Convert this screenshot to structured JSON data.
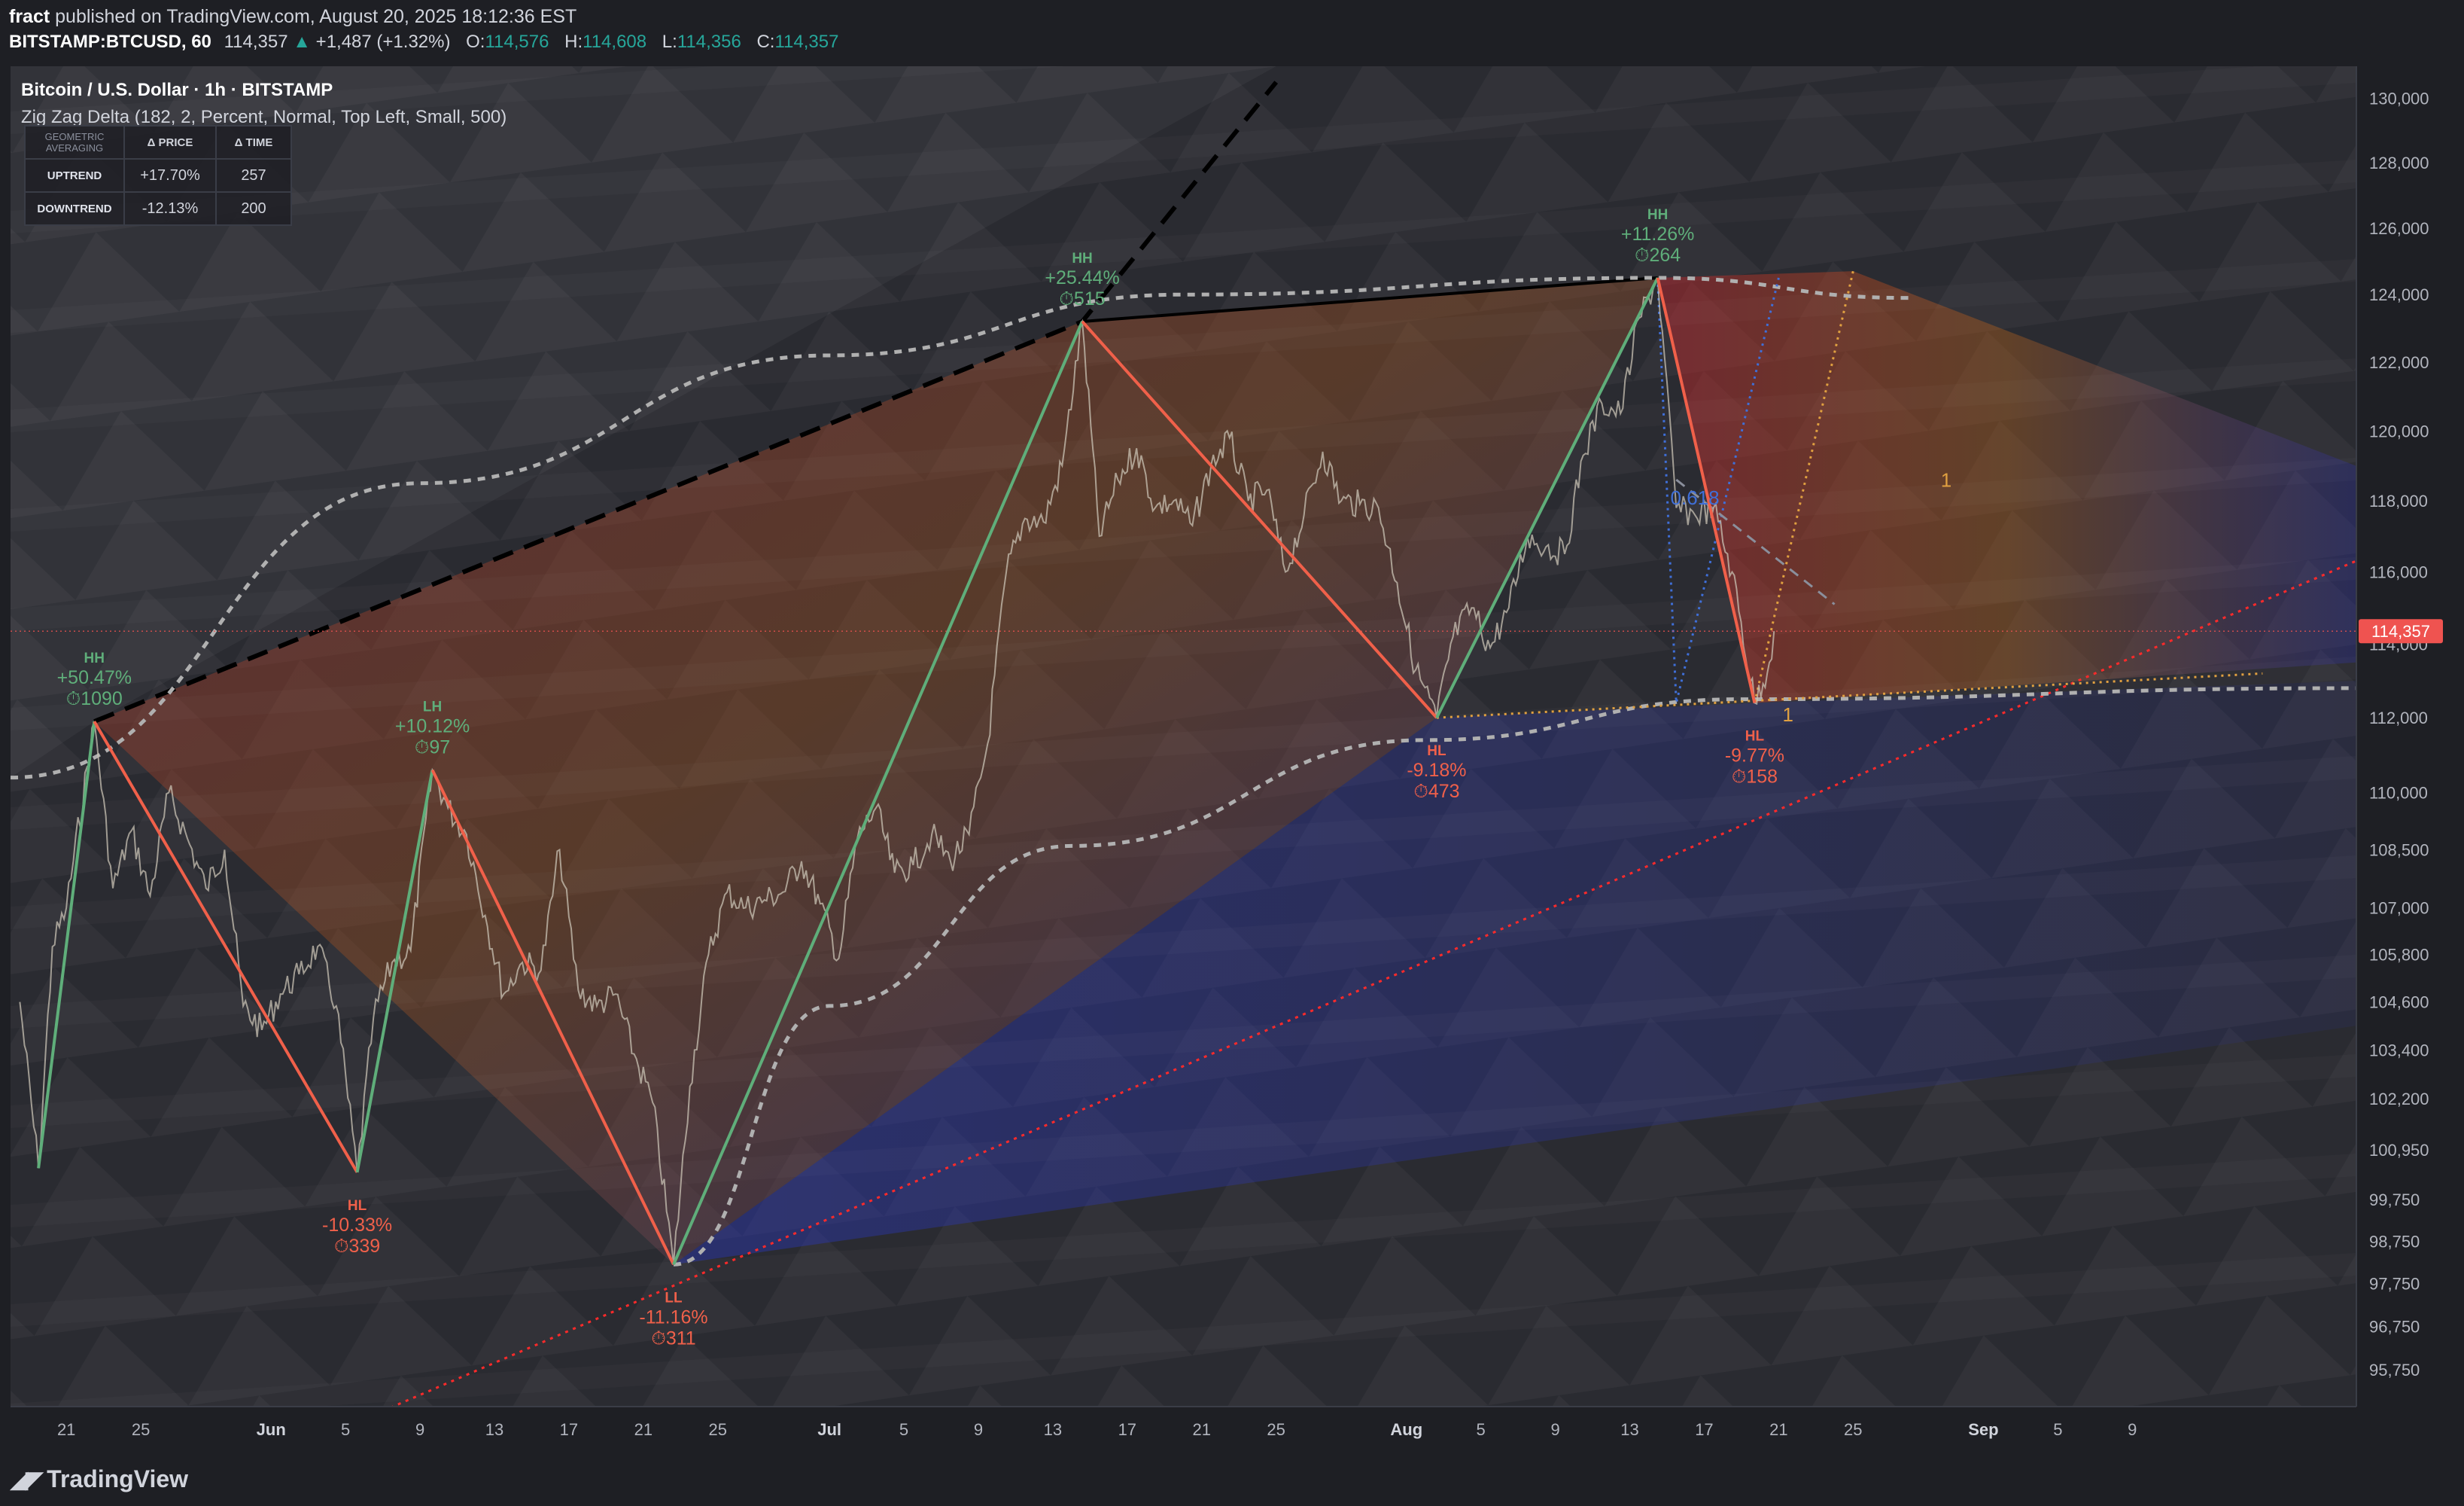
{
  "header": {
    "author": "fract",
    "published": "published on TradingView.com, August 20, 2025 18:12:36 EST",
    "symbol": "BITSTAMP:BTCUSD, 60",
    "last": "114,357",
    "change_arrow": "▲",
    "change": "+1,487 (+1.32%)",
    "open_label": "O:",
    "open": "114,576",
    "high_label": "H:",
    "high": "114,608",
    "low_label": "L:",
    "low": "114,356",
    "close_label": "C:",
    "close": "114,357"
  },
  "legend": {
    "title": "Bitcoin / U.S. Dollar · 1h · BITSTAMP",
    "indicator": "Zig Zag Delta (182, 2, Percent, Normal, Top Left, Small, 500)"
  },
  "stats_table": {
    "corner": "GEOMETRIC AVERAGING",
    "col_price": "Δ PRICE",
    "col_time": "Δ TIME",
    "rows": [
      {
        "label": "UPTREND",
        "price": "+17.70%",
        "time": "257"
      },
      {
        "label": "DOWNTREND",
        "price": "-12.13%",
        "time": "200"
      }
    ]
  },
  "footer": {
    "brand": "TradingView",
    "brand_icon": "tradingview-logo-icon"
  },
  "colors": {
    "background": "#1e1f24",
    "up": "#26a69a",
    "down": "#ef5350",
    "zig_up": "#5fae7a",
    "zig_down": "#f0604a",
    "label_up": "#5fae7a",
    "label_down": "#f0604a",
    "price_badge": "#ef5350",
    "trend_dotted": "#ff2a2a",
    "ext_dashed": "#b0b0b0"
  },
  "chart_data": {
    "type": "line",
    "title": "Bitcoin / U.S. Dollar · 1h · BITSTAMP",
    "y_scale": "log",
    "ylim": [
      94900,
      131000
    ],
    "y_ticks": [
      95750,
      96750,
      97750,
      98750,
      99750,
      100950,
      102200,
      103400,
      104600,
      105800,
      107000,
      108500,
      110000,
      112000,
      114000,
      116000,
      118000,
      120000,
      122000,
      124000,
      126000,
      128000,
      130000
    ],
    "y_tick_labels": [
      "95,750",
      "96,750",
      "97,750",
      "98,750",
      "99,750",
      "100,950",
      "102,200",
      "103,400",
      "104,600",
      "105,800",
      "107,000",
      "108,500",
      "110,000",
      "112,000",
      "114,000",
      "116,000",
      "118,000",
      "120,000",
      "122,000",
      "124,000",
      "126,000",
      "128,000",
      "130,000"
    ],
    "xlim": [
      "2025-05-18",
      "2025-09-21"
    ],
    "x_ticks": [
      {
        "date": "2025-05-21",
        "label": "21"
      },
      {
        "date": "2025-05-25",
        "label": "25"
      },
      {
        "date": "2025-06-01",
        "label": "Jun"
      },
      {
        "date": "2025-06-05",
        "label": "5"
      },
      {
        "date": "2025-06-09",
        "label": "9"
      },
      {
        "date": "2025-06-13",
        "label": "13"
      },
      {
        "date": "2025-06-17",
        "label": "17"
      },
      {
        "date": "2025-06-21",
        "label": "21"
      },
      {
        "date": "2025-06-25",
        "label": "25"
      },
      {
        "date": "2025-07-01",
        "label": "Jul"
      },
      {
        "date": "2025-07-05",
        "label": "5"
      },
      {
        "date": "2025-07-09",
        "label": "9"
      },
      {
        "date": "2025-07-13",
        "label": "13"
      },
      {
        "date": "2025-07-17",
        "label": "17"
      },
      {
        "date": "2025-07-21",
        "label": "21"
      },
      {
        "date": "2025-07-25",
        "label": "25"
      },
      {
        "date": "2025-08-01",
        "label": "Aug"
      },
      {
        "date": "2025-08-05",
        "label": "5"
      },
      {
        "date": "2025-08-09",
        "label": "9"
      },
      {
        "date": "2025-08-13",
        "label": "13"
      },
      {
        "date": "2025-08-17",
        "label": "17"
      },
      {
        "date": "2025-08-21",
        "label": "21"
      },
      {
        "date": "2025-08-25",
        "label": "25"
      },
      {
        "date": "2025-09-01",
        "label": "Sep"
      },
      {
        "date": "2025-09-05",
        "label": "5"
      },
      {
        "date": "2025-09-09",
        "label": "9"
      }
    ],
    "last_price": 114357,
    "last_price_label": "114,357",
    "zigzag": [
      {
        "date": "2025-05-19T12:00",
        "price": 100500
      },
      {
        "date": "2025-05-22T12:00",
        "price": 111900,
        "type": "HH",
        "delta": "+50.47%",
        "bars": "⏱1090",
        "dir": "up"
      },
      {
        "date": "2025-06-05T15:00",
        "price": 100400,
        "type": "HL",
        "delta": "-10.33%",
        "bars": "⏱339",
        "dir": "down"
      },
      {
        "date": "2025-06-09T16:00",
        "price": 110600,
        "type": "LH",
        "delta": "+10.12%",
        "bars": "⏱97",
        "dir": "up"
      },
      {
        "date": "2025-06-22T15:00",
        "price": 98200,
        "type": "LL",
        "delta": "-11.16%",
        "bars": "⏱311",
        "dir": "down"
      },
      {
        "date": "2025-07-14T14:00",
        "price": 123200,
        "type": "HH",
        "delta": "+25.44%",
        "bars": "⏱515",
        "dir": "up"
      },
      {
        "date": "2025-08-02T15:00",
        "price": 112000,
        "type": "HL",
        "delta": "-9.18%",
        "bars": "⏱473",
        "dir": "down"
      },
      {
        "date": "2025-08-14T12:00",
        "price": 124500,
        "type": "HH",
        "delta": "+11.26%",
        "bars": "⏱264",
        "dir": "up"
      },
      {
        "date": "2025-08-19T17:00",
        "price": 112400,
        "type": "HL",
        "delta": "-9.77%",
        "bars": "⏱158",
        "dir": "down"
      }
    ],
    "price_path": [
      [
        "2025-05-18T12:00",
        104600
      ],
      [
        "2025-05-19T12:00",
        100500
      ],
      [
        "2025-05-20T06:00",
        106000
      ],
      [
        "2025-05-21T00:00",
        107000
      ],
      [
        "2025-05-22T12:00",
        111900
      ],
      [
        "2025-05-23T12:00",
        107500
      ],
      [
        "2025-05-24T12:00",
        109000
      ],
      [
        "2025-05-25T12:00",
        107300
      ],
      [
        "2025-05-26T12:00",
        110000
      ],
      [
        "2025-05-27T12:00",
        108800
      ],
      [
        "2025-05-28T12:00",
        107500
      ],
      [
        "2025-05-29T12:00",
        108500
      ],
      [
        "2025-05-30T12:00",
        104500
      ],
      [
        "2025-05-31T12:00",
        103900
      ],
      [
        "2025-06-01T12:00",
        104800
      ],
      [
        "2025-06-02T12:00",
        105300
      ],
      [
        "2025-06-03T12:00",
        106000
      ],
      [
        "2025-06-04T12:00",
        104500
      ],
      [
        "2025-06-05T15:00",
        100400
      ],
      [
        "2025-06-06T12:00",
        104200
      ],
      [
        "2025-06-07T12:00",
        105600
      ],
      [
        "2025-06-08T12:00",
        105900
      ],
      [
        "2025-06-09T16:00",
        110600
      ],
      [
        "2025-06-10T12:00",
        109600
      ],
      [
        "2025-06-11T12:00",
        108900
      ],
      [
        "2025-06-12T12:00",
        106800
      ],
      [
        "2025-06-13T12:00",
        104800
      ],
      [
        "2025-06-14T12:00",
        105600
      ],
      [
        "2025-06-15T12:00",
        105400
      ],
      [
        "2025-06-16T12:00",
        108500
      ],
      [
        "2025-06-17T12:00",
        104900
      ],
      [
        "2025-06-18T12:00",
        104500
      ],
      [
        "2025-06-19T12:00",
        104800
      ],
      [
        "2025-06-20T12:00",
        103300
      ],
      [
        "2025-06-21T12:00",
        102100
      ],
      [
        "2025-06-22T15:00",
        98200
      ],
      [
        "2025-06-23T12:00",
        102500
      ],
      [
        "2025-06-24T12:00",
        105800
      ],
      [
        "2025-06-25T12:00",
        107400
      ],
      [
        "2025-06-26T12:00",
        107000
      ],
      [
        "2025-06-27T12:00",
        107200
      ],
      [
        "2025-06-28T12:00",
        107400
      ],
      [
        "2025-06-29T12:00",
        108200
      ],
      [
        "2025-06-30T12:00",
        107100
      ],
      [
        "2025-07-01T12:00",
        105700
      ],
      [
        "2025-07-02T12:00",
        108800
      ],
      [
        "2025-07-03T12:00",
        109600
      ],
      [
        "2025-07-04T12:00",
        107900
      ],
      [
        "2025-07-05T12:00",
        108100
      ],
      [
        "2025-07-06T12:00",
        108900
      ],
      [
        "2025-07-07T12:00",
        108200
      ],
      [
        "2025-07-08T12:00",
        108900
      ],
      [
        "2025-07-09T12:00",
        111300
      ],
      [
        "2025-07-10T12:00",
        116000
      ],
      [
        "2025-07-11T12:00",
        117500
      ],
      [
        "2025-07-12T12:00",
        117400
      ],
      [
        "2025-07-13T12:00",
        119000
      ],
      [
        "2025-07-14T14:00",
        123200
      ],
      [
        "2025-07-15T12:00",
        117000
      ],
      [
        "2025-07-16T12:00",
        118600
      ],
      [
        "2025-07-17T12:00",
        119500
      ],
      [
        "2025-07-18T12:00",
        117800
      ],
      [
        "2025-07-19T12:00",
        118000
      ],
      [
        "2025-07-20T12:00",
        117300
      ],
      [
        "2025-07-21T12:00",
        119000
      ],
      [
        "2025-07-22T12:00",
        119800
      ],
      [
        "2025-07-23T12:00",
        118000
      ],
      [
        "2025-07-24T12:00",
        118300
      ],
      [
        "2025-07-25T12:00",
        116000
      ],
      [
        "2025-07-26T12:00",
        117600
      ],
      [
        "2025-07-27T12:00",
        119400
      ],
      [
        "2025-07-28T12:00",
        118000
      ],
      [
        "2025-07-29T12:00",
        117900
      ],
      [
        "2025-07-30T12:00",
        117800
      ],
      [
        "2025-07-31T12:00",
        115700
      ],
      [
        "2025-08-01T12:00",
        113300
      ],
      [
        "2025-08-02T15:00",
        112000
      ],
      [
        "2025-08-03T12:00",
        114200
      ],
      [
        "2025-08-04T12:00",
        115000
      ],
      [
        "2025-08-05T12:00",
        113900
      ],
      [
        "2025-08-06T12:00",
        115000
      ],
      [
        "2025-08-07T12:00",
        117000
      ],
      [
        "2025-08-08T12:00",
        116700
      ],
      [
        "2025-08-09T12:00",
        116500
      ],
      [
        "2025-08-10T12:00",
        119300
      ],
      [
        "2025-08-11T12:00",
        120800
      ],
      [
        "2025-08-12T12:00",
        120500
      ],
      [
        "2025-08-13T12:00",
        123300
      ],
      [
        "2025-08-14T12:00",
        124500
      ],
      [
        "2025-08-15T12:00",
        117800
      ],
      [
        "2025-08-16T12:00",
        117600
      ],
      [
        "2025-08-17T12:00",
        117800
      ],
      [
        "2025-08-18T12:00",
        116000
      ],
      [
        "2025-08-19T17:00",
        112400
      ],
      [
        "2025-08-20T12:00",
        113500
      ],
      [
        "2025-08-20T18:00",
        114357
      ]
    ],
    "annotations": [
      {
        "text": "0.618",
        "date": "2025-08-16T12:00",
        "price": 117900
      },
      {
        "text": "1",
        "date": "2025-08-30T00:00",
        "price": 118400
      },
      {
        "text": "1",
        "date": "2025-08-21T12:00",
        "price": 111900
      }
    ],
    "trend_line_dotted_red": [
      [
        "2025-06-07T00:00",
        94800
      ],
      [
        "2025-09-21T00:00",
        116300
      ]
    ],
    "resistance_dashed_black": [
      [
        "2025-05-22T12:00",
        111900
      ],
      [
        "2025-07-14T14:00",
        123200
      ],
      [
        "2025-07-25T00:00",
        130500
      ]
    ],
    "resistance_solid_black": [
      [
        "2025-07-14T14:00",
        123200
      ],
      [
        "2025-08-14T12:00",
        124500
      ]
    ],
    "arc_upper": [
      [
        "2025-05-18T00:00",
        110400
      ],
      [
        "2025-06-09T00:00",
        118500
      ],
      [
        "2025-07-01T00:00",
        122200
      ],
      [
        "2025-07-20T00:00",
        124000
      ],
      [
        "2025-08-14T12:00",
        124500
      ],
      [
        "2025-08-28T00:00",
        123900
      ]
    ],
    "arc_lower": [
      [
        "2025-06-22T15:00",
        98200
      ],
      [
        "2025-07-01T00:00",
        104500
      ],
      [
        "2025-07-14T00:00",
        108600
      ],
      [
        "2025-08-02T00:00",
        111400
      ],
      [
        "2025-08-19T00:00",
        112500
      ],
      [
        "2025-09-21T00:00",
        112800
      ]
    ],
    "support_dotted_orange": [
      [
        "2025-08-02T15:00",
        112000
      ],
      [
        "2025-09-16T00:00",
        113200
      ]
    ],
    "projection_dotted_orange": [
      [
        "2025-08-19T17:00",
        112400
      ],
      [
        "2025-08-25T00:00",
        124700
      ]
    ],
    "projection_dotted_blue": [
      [
        "2025-08-14T12:00",
        124500
      ],
      [
        "2025-08-15T12:00",
        112400
      ],
      [
        "2025-08-21T00:00",
        124500
      ]
    ],
    "projection_dashed_grey": [
      [
        "2025-08-15T12:00",
        118600
      ],
      [
        "2025-08-24T00:00",
        115100
      ]
    ]
  }
}
